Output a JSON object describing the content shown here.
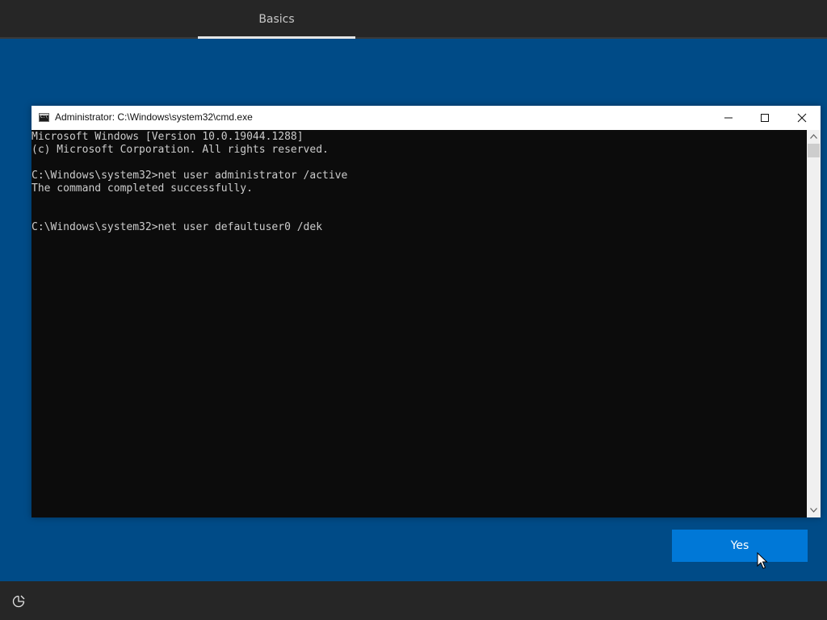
{
  "header": {
    "tab_label": "Basics"
  },
  "cmd_window": {
    "title": "Administrator: C:\\Windows\\system32\\cmd.exe",
    "icon": "cmd-app-icon",
    "controls": [
      "minimize-icon",
      "maximize-icon",
      "close-icon"
    ],
    "console_lines": [
      "Microsoft Windows [Version 10.0.19044.1288]",
      "(c) Microsoft Corporation. All rights reserved.",
      "",
      "C:\\Windows\\system32>net user administrator /active",
      "The command completed successfully.",
      "",
      "",
      "C:\\Windows\\system32>net user defaultuser0 /dek"
    ]
  },
  "footer": {
    "yes_label": "Yes",
    "accessibility_icon": "ease-of-access-icon"
  },
  "colors": {
    "background": "#004b87",
    "bar": "#262626",
    "console_bg": "#0c0c0c",
    "console_text": "#cccccc",
    "accent_button": "#0078d7"
  }
}
